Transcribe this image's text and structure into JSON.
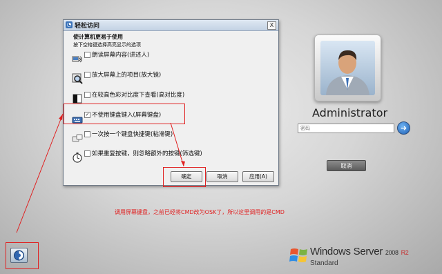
{
  "dialog": {
    "title": "轻松访问",
    "close_glyph": "X",
    "heading": "使计算机更易于使用",
    "subheading": "按下空格键选择高亮显示的选项",
    "options": [
      {
        "label": "朗读屏幕内容(讲述人)",
        "checked": false,
        "icon": "narrator-icon"
      },
      {
        "label": "放大屏幕上的项目(放大镜)",
        "checked": false,
        "icon": "magnifier-icon"
      },
      {
        "label": "在较高色彩对比度下查看(高对比度)",
        "checked": false,
        "icon": "high-contrast-icon"
      },
      {
        "label": "不使用键盘键入(屏幕键盘)",
        "checked": true,
        "icon": "on-screen-keyboard-icon"
      },
      {
        "label": "一次按一个键盘快捷键(粘滞键)",
        "checked": false,
        "icon": "sticky-keys-icon"
      },
      {
        "label": "如果重复按键，则忽略额外的按键(筛选键)",
        "checked": false,
        "icon": "filter-keys-icon"
      }
    ],
    "checkmark": "✓",
    "buttons": {
      "ok": "确定",
      "cancel": "取消",
      "apply": "应用(A)"
    }
  },
  "annotation": {
    "text": "调用屏幕键盘，之前已经将CMD改为OSK了，所以这里调用的是CMD",
    "color": "#e02020"
  },
  "login": {
    "username": "Administrator",
    "password_placeholder": "密码",
    "go_glyph": "➜",
    "cancel_label": "取消"
  },
  "branding": {
    "name": "Windows Server",
    "version": "2008",
    "release": "R2",
    "edition": "Standard"
  },
  "colors": {
    "accent": "#1e5fb4",
    "annotation": "#e02020"
  }
}
